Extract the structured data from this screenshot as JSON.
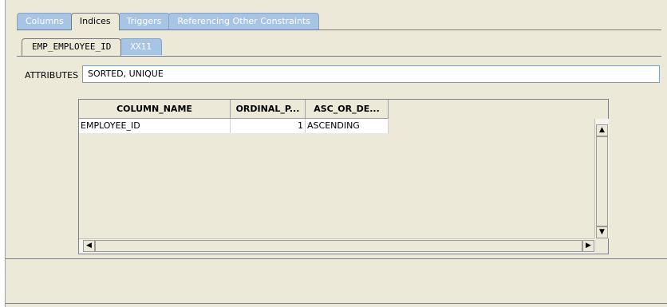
{
  "tabs": [
    {
      "label": "Columns",
      "active": false
    },
    {
      "label": "Indices",
      "active": true
    },
    {
      "label": "Triggers",
      "active": false
    },
    {
      "label": "Referencing Other Constraints",
      "active": false
    }
  ],
  "subtabs": [
    {
      "label": "EMP_EMPLOYEE_ID",
      "active": true
    },
    {
      "label": "XX11",
      "active": false
    }
  ],
  "attributes": {
    "label": "ATTRIBUTES",
    "value": "SORTED, UNIQUE"
  },
  "grid": {
    "columns": [
      "COLUMN_NAME",
      "ORDINAL_P...",
      "ASC_OR_DE..."
    ],
    "rows": [
      [
        "EMPLOYEE_ID",
        "1",
        "ASCENDING"
      ]
    ]
  },
  "scroll_icons": {
    "up": "▲",
    "down": "▼",
    "left": "◀",
    "right": "▶"
  }
}
